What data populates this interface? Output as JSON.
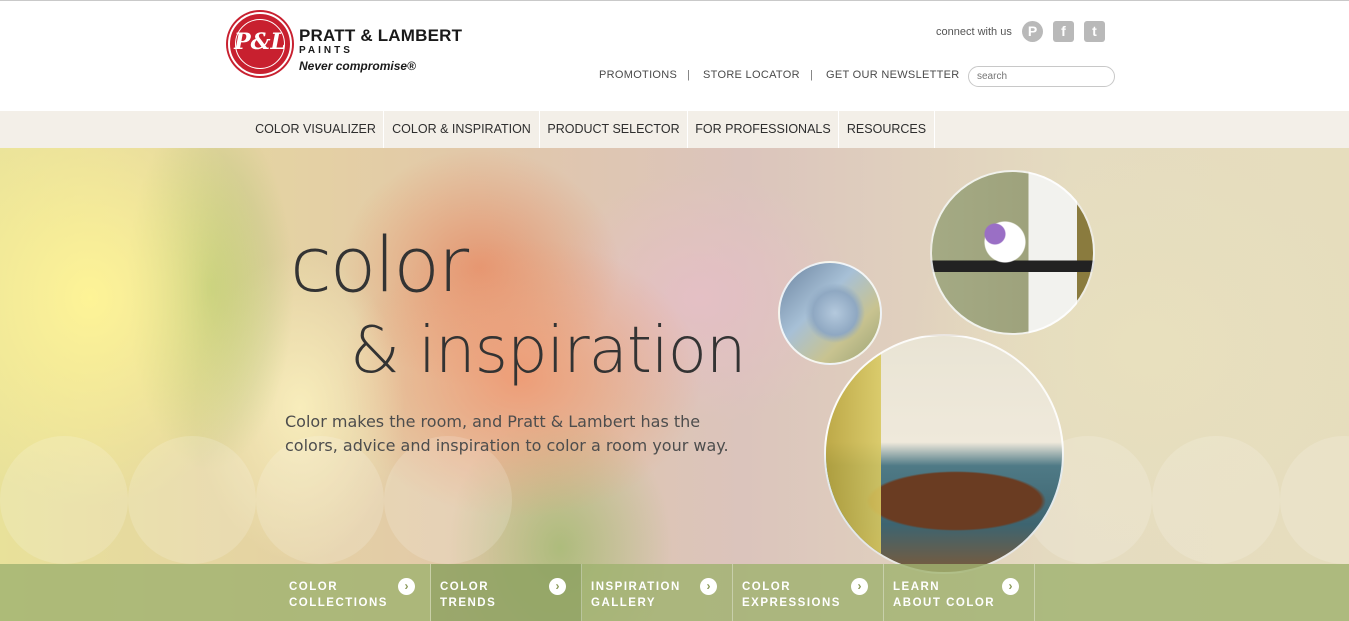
{
  "brand": {
    "monogram": "P&L",
    "name": "PRATT & LAMBERT",
    "subname": "PAINTS",
    "tagline": "Never compromise®"
  },
  "social": {
    "label": "connect with us",
    "pinterest_glyph": "P",
    "facebook_glyph": "f",
    "twitter_glyph": "t"
  },
  "utility_links": [
    "PROMOTIONS",
    "STORE LOCATOR",
    "GET OUR NEWSLETTER"
  ],
  "search": {
    "placeholder": "search"
  },
  "nav": [
    "COLOR VISUALIZER",
    "COLOR & INSPIRATION",
    "PRODUCT SELECTOR",
    "FOR PROFESSIONALS",
    "RESOURCES"
  ],
  "hero": {
    "title_line1": "color",
    "title_line2": "& inspiration",
    "description": "Color makes the room, and Pratt & Lambert has the colors, advice and inspiration to color a room your way."
  },
  "tiles": [
    {
      "label": "COLOR\nCOLLECTIONS",
      "arrow": "›"
    },
    {
      "label": "COLOR\nTRENDS",
      "arrow": "›"
    },
    {
      "label": "INSPIRATION\nGALLERY",
      "arrow": "›"
    },
    {
      "label": "COLOR\nEXPRESSIONS",
      "arrow": "›"
    },
    {
      "label": "LEARN\nABOUT COLOR",
      "arrow": "›"
    }
  ],
  "colors": {
    "brand_red": "#c8202f",
    "tile_green": "#a0b270",
    "nav_bg": "#f3efe8"
  }
}
